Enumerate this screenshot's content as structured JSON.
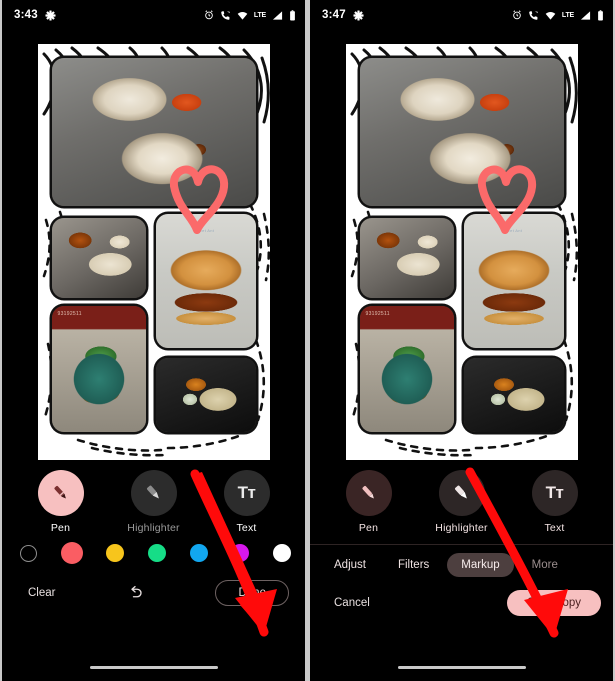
{
  "panels": [
    {
      "id": "markup-pen-panel",
      "statusbar": {
        "time": "3:43",
        "icons_left": [
          "asterisk-icon"
        ],
        "icons_right": [
          "alarm-icon",
          "missed-call-icon",
          "wifi-icon",
          "lte-label",
          "signal-icon",
          "battery-icon"
        ],
        "network_label": "LTE"
      },
      "tools": [
        {
          "name": "pen",
          "label": "Pen",
          "icon": "pen-icon",
          "selected": true
        },
        {
          "name": "highlighter",
          "label": "Highlighter",
          "icon": "highlighter-icon",
          "selected": false
        },
        {
          "name": "text",
          "label": "Text",
          "icon": "text-icon",
          "glyph": "Tт",
          "selected": false
        }
      ],
      "swatches": [
        {
          "name": "eraser-swatch",
          "color": "transparent",
          "selected": false
        },
        {
          "name": "red-swatch",
          "color": "#fa5d63",
          "selected": false
        },
        {
          "name": "yellow-swatch",
          "color": "#f7c51c",
          "selected": false
        },
        {
          "name": "green-swatch",
          "color": "#16dd87",
          "selected": false
        },
        {
          "name": "blue-swatch",
          "color": "#12a7f0",
          "selected": false
        },
        {
          "name": "magenta-swatch",
          "color": "#d818ee",
          "selected": false
        },
        {
          "name": "white-swatch",
          "color": "#ffffff",
          "selected": true
        }
      ],
      "footer": {
        "clear_label": "Clear",
        "undo_icon": "undo-icon",
        "done_label": "Done"
      }
    },
    {
      "id": "markup-editor-panel",
      "statusbar": {
        "time": "3:47",
        "icons_left": [
          "asterisk-icon"
        ],
        "icons_right": [
          "alarm-icon",
          "missed-call-icon",
          "wifi-icon",
          "lte-label",
          "signal-icon",
          "battery-icon"
        ],
        "network_label": "LTE"
      },
      "tools": [
        {
          "name": "pen",
          "label": "Pen",
          "icon": "pen-icon",
          "selected": false
        },
        {
          "name": "highlighter",
          "label": "Highlighter",
          "icon": "highlighter-icon",
          "selected": false
        },
        {
          "name": "text",
          "label": "Text",
          "icon": "text-icon",
          "glyph": "Tт",
          "selected": false
        }
      ],
      "modes": [
        {
          "name": "adjust",
          "label": "Adjust",
          "active": false
        },
        {
          "name": "filters",
          "label": "Filters",
          "active": false
        },
        {
          "name": "markup",
          "label": "Markup",
          "active": true
        },
        {
          "name": "more",
          "label": "More",
          "active": false
        }
      ],
      "footer": {
        "cancel_label": "Cancel",
        "save_label": "Save copy"
      }
    }
  ],
  "photo": {
    "description": "food photo collage with white border and black doodle lines",
    "tiles": [
      {
        "name": "rice-curry-thali-photo",
        "caption": ""
      },
      {
        "name": "roti-plate-photo",
        "caption": ""
      },
      {
        "name": "burger-photo",
        "caption": "Sweet Ant"
      },
      {
        "name": "chaat-bowl-photo",
        "caption": "93192511"
      },
      {
        "name": "black-plate-photo",
        "caption": ""
      }
    ],
    "markup_drawing": {
      "name": "heart-doodle",
      "color": "#fb6a6a"
    }
  },
  "annotations": [
    {
      "name": "arrow-to-done",
      "color": "#ff0a0a",
      "points_to": "Done"
    },
    {
      "name": "arrow-to-save-copy",
      "color": "#ff0a0a",
      "points_to": "Save copy"
    }
  ],
  "colors": {
    "accent_pink": "#f7c0c0",
    "pen_selected_bg": "#f7c0c0",
    "arrow_red": "#ff0a0a",
    "heart_red": "#fb6a6a",
    "active_mode_bg": "#4d3f3f",
    "background": "#000000"
  }
}
